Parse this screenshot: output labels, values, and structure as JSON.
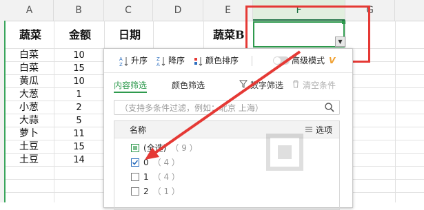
{
  "columns": [
    "A",
    "B",
    "C",
    "D",
    "E",
    "F",
    "G"
  ],
  "headers": {
    "a": "蔬菜",
    "b": "金额",
    "c": "日期",
    "e": "蔬菜B"
  },
  "rows": [
    {
      "veg": "白菜",
      "amount": "10"
    },
    {
      "veg": "白菜",
      "amount": "15"
    },
    {
      "veg": "黄瓜",
      "amount": "10"
    },
    {
      "veg": "大葱",
      "amount": "1"
    },
    {
      "veg": "小葱",
      "amount": "2"
    },
    {
      "veg": "大蒜",
      "amount": "5"
    },
    {
      "veg": "萝卜",
      "amount": "11"
    },
    {
      "veg": "土豆",
      "amount": "15"
    },
    {
      "veg": "土豆",
      "amount": "14"
    }
  ],
  "toolbar": {
    "sort_asc": "升序",
    "sort_desc": "降序",
    "color_sort": "颜色排序",
    "advanced": "高级模式"
  },
  "tabs": {
    "content": "内容筛选",
    "color": "颜色筛选",
    "number": "数字筛选",
    "clear": "清空条件"
  },
  "search": {
    "placeholder": "（支持多条件过滤，例如：北京 上海）"
  },
  "list": {
    "name_header": "名称",
    "options_label": "选项",
    "items": [
      {
        "label": "(全选)",
        "count": "（ 9 ）"
      },
      {
        "label": "0",
        "count": "（ 4 ）"
      },
      {
        "label": "1",
        "count": "（ 4 ）"
      },
      {
        "label": "2",
        "count": "（ 1 ）"
      }
    ]
  },
  "colors": {
    "accent": "#2e9a4d",
    "highlight": "#e53935",
    "advanced_v": "#f0a030"
  }
}
